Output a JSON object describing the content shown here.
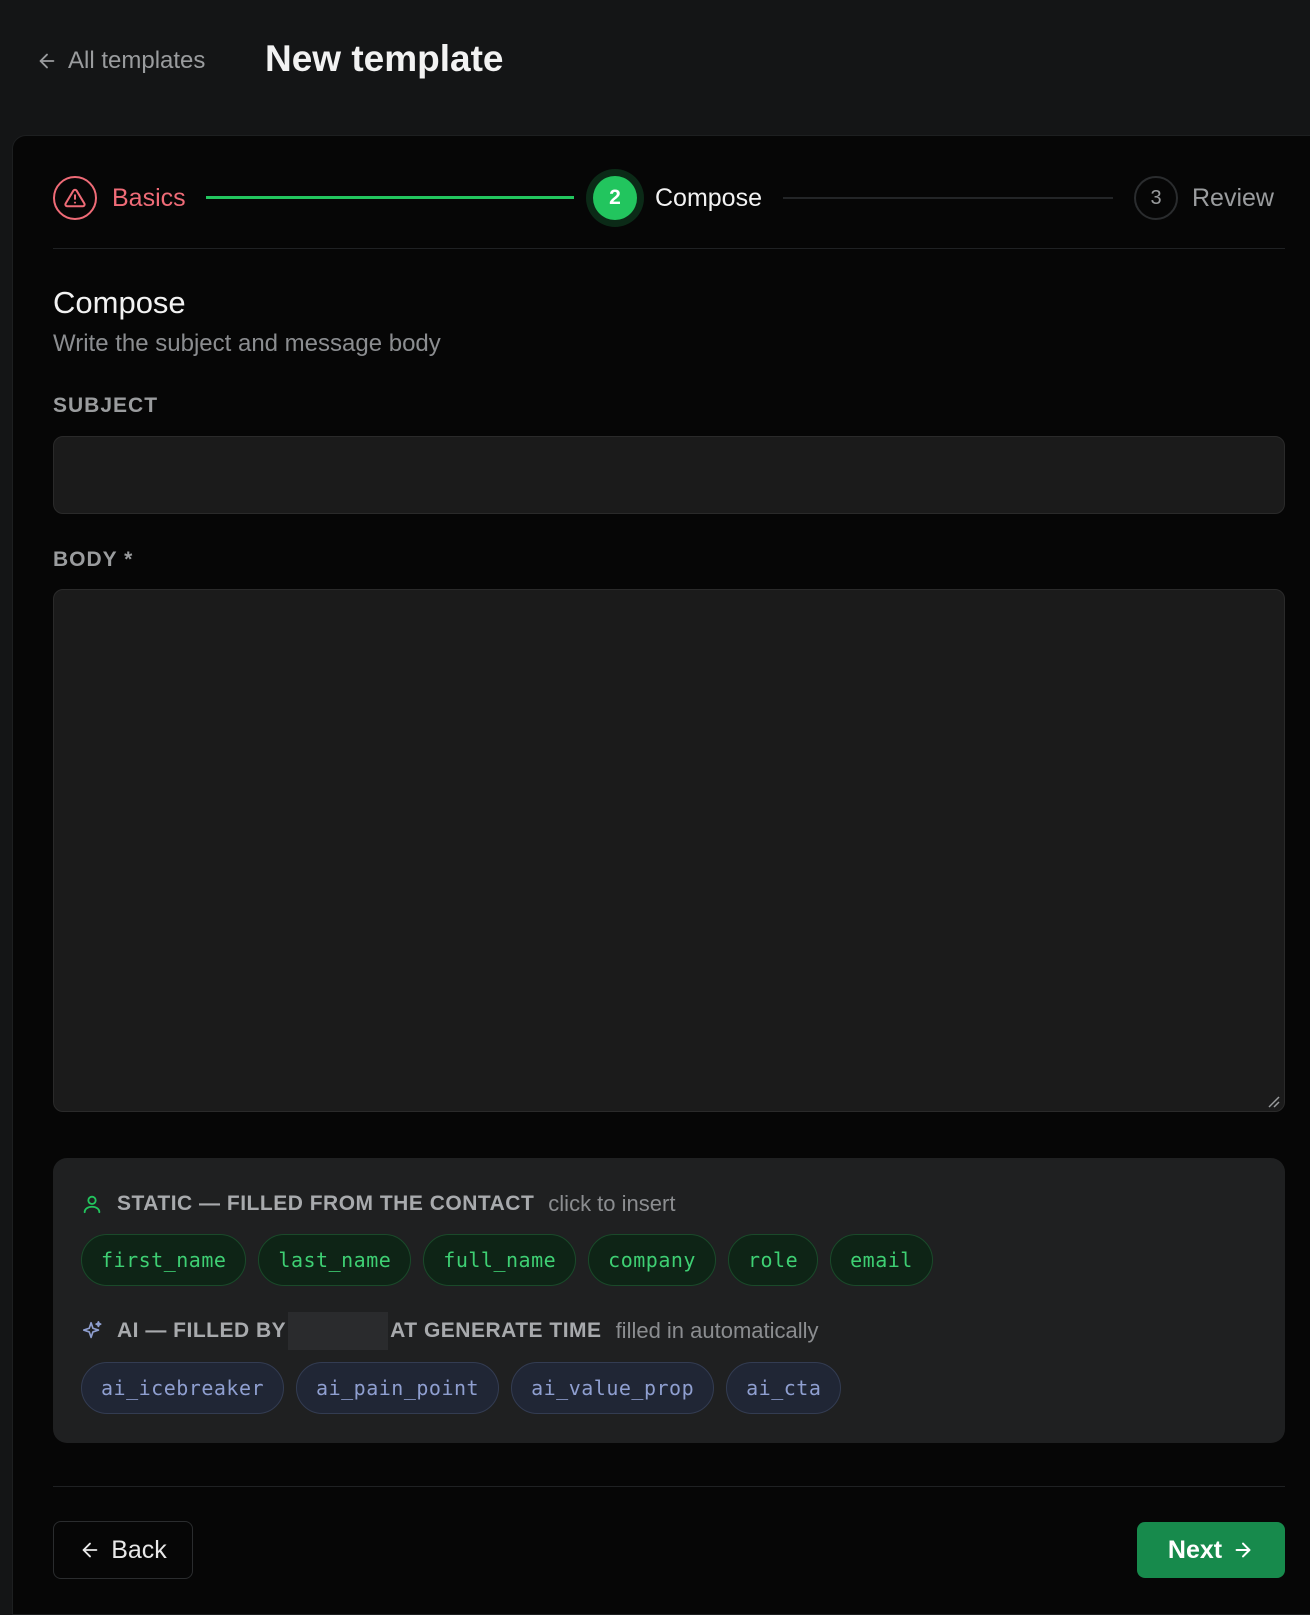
{
  "header": {
    "back_label": "All templates",
    "title": "New template"
  },
  "stepper": {
    "steps": [
      {
        "label": "Basics",
        "state": "error",
        "icon": "warning-icon"
      },
      {
        "number": "2",
        "label": "Compose",
        "state": "active"
      },
      {
        "number": "3",
        "label": "Review",
        "state": "upcoming"
      }
    ]
  },
  "compose": {
    "title": "Compose",
    "subtitle": "Write the subject and message body",
    "subject_label": "SUBJECT",
    "subject_value": "",
    "body_label": "BODY *",
    "body_value": ""
  },
  "variables": {
    "static": {
      "icon": "user-icon",
      "title": "STATIC — FILLED FROM THE CONTACT",
      "hint": "click to insert",
      "chips": [
        "first_name",
        "last_name",
        "full_name",
        "company",
        "role",
        "email"
      ]
    },
    "ai": {
      "icon": "sparkle-icon",
      "title_before": "AI — FILLED BY",
      "title_after": "AT GENERATE TIME",
      "hint": "filled in automatically",
      "chips": [
        "ai_icebreaker",
        "ai_pain_point",
        "ai_value_prop",
        "ai_cta"
      ]
    }
  },
  "footer": {
    "back_label": "Back",
    "next_label": "Next"
  },
  "colors": {
    "accent_green": "#22c55e",
    "button_green": "#178a4c",
    "error_red": "#ef6b77",
    "ai_chip_text": "#8f9fd0"
  }
}
